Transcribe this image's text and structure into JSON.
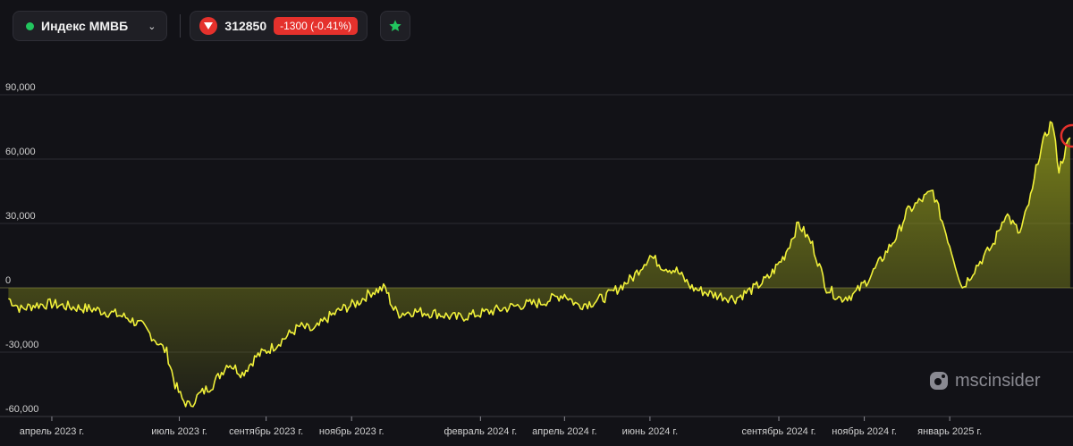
{
  "toolbar": {
    "ticker_name": "Индекс ММВБ",
    "price": "312850",
    "change": "-1300 (-0.41%)",
    "status_color": "#22c55e",
    "down_color": "#e5312c",
    "fav_color": "#22c55e"
  },
  "watermark": {
    "brand": "mscinsider"
  },
  "chart_data": {
    "type": "area",
    "title": "",
    "xlabel": "",
    "ylabel": "",
    "ylim": [
      -60000,
      110000
    ],
    "yticks": [
      90000,
      60000,
      30000,
      0,
      -30000,
      -60000
    ],
    "ytick_labels": [
      "90,000",
      "60,000",
      "30,000",
      "0",
      "-30,000",
      "-60,000"
    ],
    "xlim": [
      "2023-02-23",
      "2025-03-30"
    ],
    "xticks": [
      "2023-04-01",
      "2023-07-01",
      "2023-09-01",
      "2023-11-01",
      "2024-02-01",
      "2024-04-01",
      "2024-06-01",
      "2024-09-01",
      "2024-11-01",
      "2025-01-01"
    ],
    "xtick_labels": [
      "апрель 2023 г.",
      "июль 2023 г.",
      "сентябрь 2023 г.",
      "ноябрь 2023 г.",
      "февраль 2024 г.",
      "апрель 2024 г.",
      "июнь 2024 г.",
      "сентябрь 2024 г.",
      "ноябрь 2024 г.",
      "январь 2025 г."
    ],
    "line_color": "#f0f03a",
    "fill_color": "#9aa31c",
    "highlight_color": "#e5312c",
    "grid": true,
    "series": [
      {
        "x": [
          "2023-03-01",
          "2023-03-10",
          "2023-03-20",
          "2023-04-01",
          "2023-04-15",
          "2023-05-01",
          "2023-05-15",
          "2023-05-25",
          "2023-06-05",
          "2023-06-15",
          "2023-06-22",
          "2023-06-28",
          "2023-07-03",
          "2023-07-08",
          "2023-07-15",
          "2023-07-25",
          "2023-08-05",
          "2023-08-15",
          "2023-08-25",
          "2023-09-05",
          "2023-09-15",
          "2023-09-25",
          "2023-10-05",
          "2023-10-15",
          "2023-10-25",
          "2023-11-05",
          "2023-11-15",
          "2023-11-25",
          "2023-12-01",
          "2023-12-05",
          "2023-12-15",
          "2024-01-01",
          "2024-01-15",
          "2024-02-01",
          "2024-02-15",
          "2024-03-01",
          "2024-03-15",
          "2024-04-01",
          "2024-04-10",
          "2024-04-20",
          "2024-05-01",
          "2024-05-10",
          "2024-05-20",
          "2024-06-01",
          "2024-06-10",
          "2024-06-20",
          "2024-07-01",
          "2024-07-15",
          "2024-08-01",
          "2024-08-15",
          "2024-08-25",
          "2024-09-05",
          "2024-09-15",
          "2024-09-25",
          "2024-10-05",
          "2024-10-15",
          "2024-10-25",
          "2024-11-05",
          "2024-11-15",
          "2024-11-25",
          "2024-12-01",
          "2024-12-10",
          "2024-12-20",
          "2025-01-01",
          "2025-01-10",
          "2025-01-20",
          "2025-02-01",
          "2025-02-10",
          "2025-02-20",
          "2025-03-01",
          "2025-03-05",
          "2025-03-10",
          "2025-03-15",
          "2025-03-20",
          "2025-03-25",
          "2025-03-28"
        ],
        "values": [
          -5000,
          -10000,
          -8000,
          -7500,
          -9000,
          -10000,
          -12000,
          -14000,
          -18000,
          -25000,
          -30000,
          -45000,
          -52000,
          -55000,
          -50000,
          -45000,
          -35000,
          -40000,
          -32000,
          -28000,
          -23000,
          -18000,
          -20000,
          -14000,
          -10000,
          -7000,
          -2000,
          0,
          -10000,
          -12000,
          -11000,
          -12000,
          -14000,
          -12000,
          -10000,
          -8000,
          -7000,
          -3000,
          -8000,
          -7000,
          -4000,
          0,
          5000,
          15000,
          10000,
          8000,
          0,
          -3000,
          -5000,
          0,
          5000,
          15000,
          30000,
          20000,
          0,
          -5000,
          -3000,
          5000,
          15000,
          25000,
          35000,
          40000,
          45000,
          20000,
          0,
          10000,
          20000,
          35000,
          25000,
          45000,
          60000,
          70000,
          78000,
          55000,
          65000,
          70000
        ]
      }
    ]
  }
}
